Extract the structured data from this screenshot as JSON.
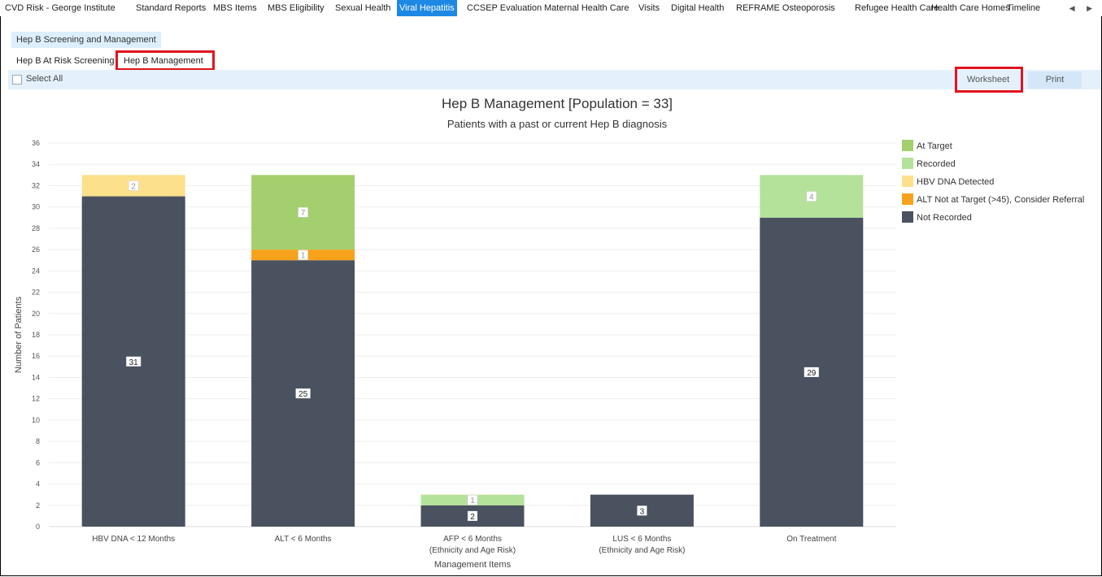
{
  "nav": {
    "tabs": [
      {
        "label": "CVD Risk - George Institute",
        "active": false
      },
      {
        "label": "Standard Reports",
        "active": false
      },
      {
        "label": "MBS Items",
        "active": false
      },
      {
        "label": "MBS Eligibility",
        "active": false
      },
      {
        "label": "Sexual Health",
        "active": false
      },
      {
        "label": "Viral Hepatitis",
        "active": true
      },
      {
        "label": "CCSEP Evaluation",
        "active": false
      },
      {
        "label": "Maternal Health Care",
        "active": false
      },
      {
        "label": "Visits",
        "active": false
      },
      {
        "label": "Digital Health",
        "active": false
      },
      {
        "label": "REFRAME Osteoporosis",
        "active": false
      },
      {
        "label": "Refugee Health Care",
        "active": false
      },
      {
        "label": "Health Care Homes",
        "active": false
      },
      {
        "label": "Timeline",
        "active": false
      }
    ],
    "scroll_icons": "◀ ▶"
  },
  "section": {
    "header": "Hep B Screening and Management",
    "subtabs": [
      {
        "label": "Hep B At Risk Screening",
        "active": false
      },
      {
        "label": "Hep B Management",
        "active": true
      }
    ]
  },
  "toolbar": {
    "select_all_label": "Select All",
    "worksheet_label": "Worksheet",
    "print_label": "Print"
  },
  "colors": {
    "at_target": "#a3cf6e",
    "recorded": "#b5e29a",
    "hbv_dna_detected": "#fde08c",
    "alt_not_at_target": "#f7a21b",
    "not_recorded": "#4a5260",
    "highlight": "#e0141e",
    "active_tab": "#1e88e5"
  },
  "chart_data": {
    "type": "bar",
    "stacked": true,
    "title": "Hep B Management [Population = 33]",
    "subtitle": "Patients with a past or current Hep B diagnosis",
    "xlabel": "Management Items",
    "ylabel": "Number of Patients",
    "ylim": [
      0,
      36
    ],
    "ytick_step": 2,
    "categories": [
      [
        "HBV DNA < 12 Months"
      ],
      [
        "ALT < 6 Months"
      ],
      [
        "AFP < 6 Months",
        "(Ethnicity and Age Risk)"
      ],
      [
        "LUS < 6 Months",
        "(Ethnicity and Age Risk)"
      ],
      [
        "On Treatment"
      ]
    ],
    "series": [
      {
        "name": "Not Recorded",
        "color": "#4a5260",
        "values": [
          31,
          25,
          2,
          3,
          29
        ]
      },
      {
        "name": "ALT Not at Target (>45), Consider Referral",
        "color": "#f7a21b",
        "values": [
          0,
          1,
          0,
          0,
          0
        ]
      },
      {
        "name": "HBV DNA Detected",
        "color": "#fde08c",
        "values": [
          2,
          0,
          0,
          0,
          0
        ]
      },
      {
        "name": "Recorded",
        "color": "#b5e29a",
        "values": [
          0,
          0,
          1,
          0,
          4
        ]
      },
      {
        "name": "At Target",
        "color": "#a3cf6e",
        "values": [
          0,
          7,
          0,
          0,
          0
        ]
      }
    ],
    "legend_order": [
      "At Target",
      "Recorded",
      "HBV DNA Detected",
      "ALT Not at Target (>45), Consider Referral",
      "Not Recorded"
    ],
    "legend_position": "right",
    "grid": true
  }
}
